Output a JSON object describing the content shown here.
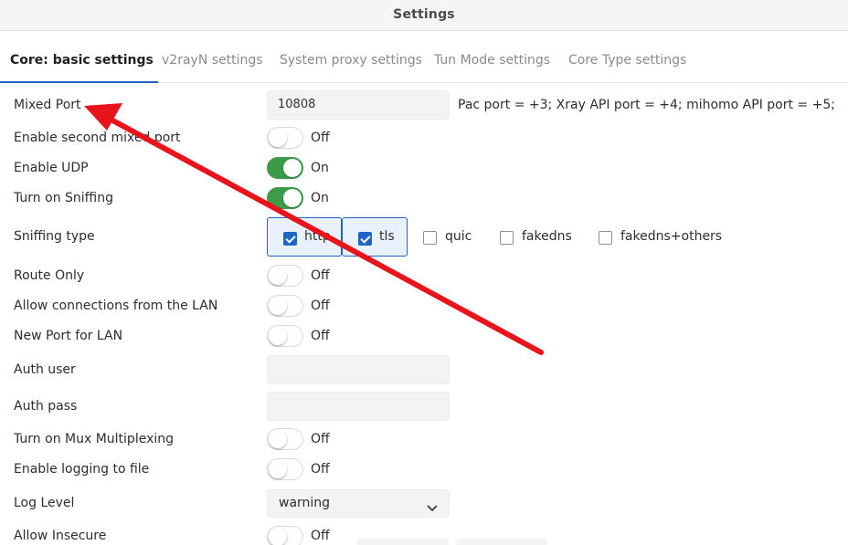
{
  "window": {
    "title": "Settings"
  },
  "tabs": [
    {
      "label": "Core: basic settings"
    },
    {
      "label": "v2rayN settings"
    },
    {
      "label": "System proxy settings"
    },
    {
      "label": "Tun Mode settings"
    },
    {
      "label": "Core Type settings"
    }
  ],
  "settings": {
    "mixed_port": {
      "label": "Mixed Port",
      "value": "10808",
      "hint": "Pac port = +3; Xray API port = +4; mihomo API port = +5;"
    },
    "second_mixed_port": {
      "label": "Enable second mixed port",
      "state": "Off"
    },
    "enable_udp": {
      "label": "Enable UDP",
      "state": "On"
    },
    "sniffing": {
      "label": "Turn on Sniffing",
      "state": "On"
    },
    "sniffing_type": {
      "label": "Sniffing type",
      "options": [
        {
          "label": "http",
          "checked": true
        },
        {
          "label": "tls",
          "checked": true
        },
        {
          "label": "quic",
          "checked": false
        },
        {
          "label": "fakedns",
          "checked": false
        },
        {
          "label": "fakedns+others",
          "checked": false
        }
      ]
    },
    "route_only": {
      "label": "Route Only",
      "state": "Off"
    },
    "allow_lan": {
      "label": "Allow connections from the LAN",
      "state": "Off"
    },
    "new_port_lan": {
      "label": "New Port for LAN",
      "state": "Off"
    },
    "auth_user": {
      "label": "Auth user",
      "value": ""
    },
    "auth_pass": {
      "label": "Auth pass",
      "value": ""
    },
    "mux": {
      "label": "Turn on Mux Multiplexing",
      "state": "Off"
    },
    "log_to_file": {
      "label": "Enable logging to file",
      "state": "Off"
    },
    "log_level": {
      "label": "Log Level",
      "value": "warning"
    },
    "allow_insecure": {
      "label": "Allow Insecure",
      "state": "Off"
    }
  },
  "colors": {
    "accent": "#1e63c6",
    "toggle_on": "#3c9a48",
    "annotation_arrow": "#e8131b"
  },
  "icons": {
    "dropdown": "chevron-down-icon",
    "annotation": "red-arrow-annotation"
  }
}
